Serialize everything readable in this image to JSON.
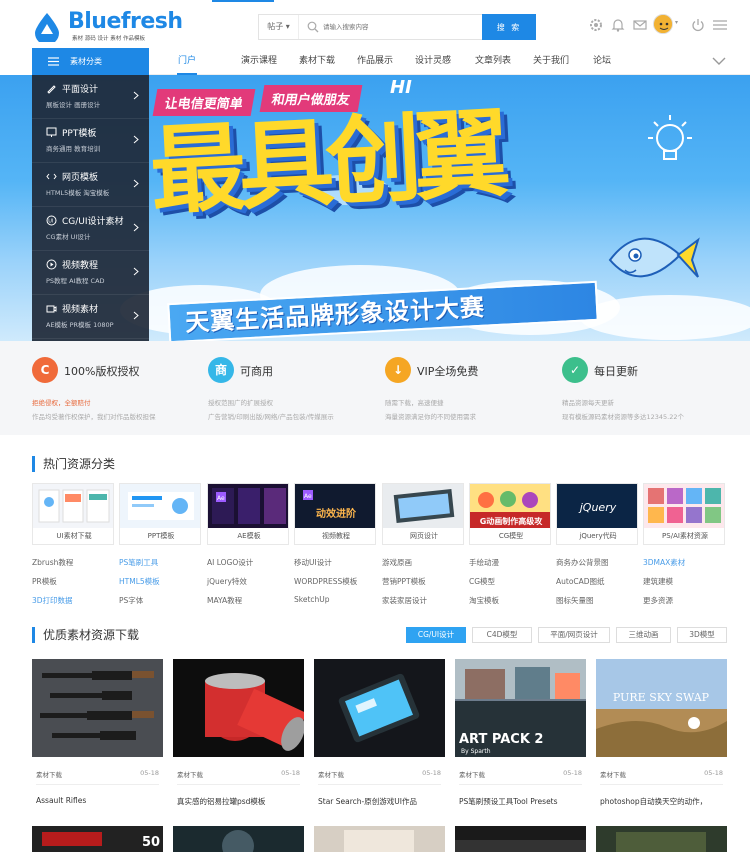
{
  "colors": {
    "accent": "#1e88e5",
    "sidebar_bg": "#1e2837",
    "feature_bg": "#f5f6f8",
    "tab_active": "#2fa3f2"
  },
  "header": {
    "logo_text": "Bluefresh",
    "logo_tagline": "素材 源码 设计 素材 作品模板",
    "search": {
      "category": "帖子",
      "placeholder": "请输入搜索内容",
      "button": "搜 索"
    },
    "icons": [
      "gear-icon",
      "bell-icon",
      "mail-icon",
      "avatar",
      "power-icon",
      "menu-icon"
    ]
  },
  "nav": {
    "category_button": "素材分类",
    "items": [
      "门户",
      "演示课程",
      "素材下载",
      "作品展示",
      "设计灵感",
      "文章列表",
      "关于我们",
      "论坛"
    ],
    "active_index": 0
  },
  "sidebar": {
    "items": [
      {
        "title": "平面设计",
        "sub": "展板设计   画册设计",
        "icon": "pen-icon"
      },
      {
        "title": "PPT模板",
        "sub": "商务通用   教育培训",
        "icon": "ppt-icon"
      },
      {
        "title": "网页模板",
        "sub": "HTML5模板   淘宝模板",
        "icon": "code-icon"
      },
      {
        "title": "CG/UI设计素材",
        "sub": "CG素材   UI设计",
        "icon": "ui-icon"
      },
      {
        "title": "视频教程",
        "sub": "PS教程   AI教程   CAD",
        "icon": "play-icon"
      },
      {
        "title": "视频素材",
        "sub": "AE模板   PR模板   1080P",
        "icon": "video-icon"
      }
    ]
  },
  "banner": {
    "tag1": "让电信更简单",
    "tag2": "和用户做朋友",
    "hi": "HI",
    "main": "最具创翼",
    "ribbon": "天翼生活品牌形象设计大赛"
  },
  "features": [
    {
      "icon_text": "C",
      "color": "#f06a3a",
      "title": "100%版权授权",
      "line1": "拒绝侵权，全额赔付",
      "line1_red": true,
      "line2": "作品均受著作权保护，我们对作品版权担保"
    },
    {
      "icon_text": "商",
      "color": "#35b7e8",
      "title": "可商用",
      "line1": "授权范围广的扩展授权",
      "line1_red": false,
      "line2": "广告营销/印刷出版/网络/产品包装/传媒展示"
    },
    {
      "icon_text": "↓",
      "color": "#f5a623",
      "title": "VIP全场免费",
      "line1": "随需下载，高速便捷",
      "line1_red": false,
      "line2": "海量资源满足你的不同使用需求"
    },
    {
      "icon_text": "✓",
      "color": "#3cbf8c",
      "title": "每日更新",
      "line1": "精品资源每天更新",
      "line1_red": false,
      "line2": "现有模板源码素材资源等多达12345.22个"
    }
  ],
  "hot": {
    "title": "热门资源分类",
    "categories": [
      "UI素材下载",
      "PPT模板",
      "AE模板",
      "视频教程",
      "网页设计",
      "CG模型",
      "jQuery代码",
      "PS/AI素材资源"
    ],
    "links": [
      [
        "Zbrush教程",
        "PS笔刷工具",
        "AI LOGO设计",
        "移动UI设计",
        "游戏原画",
        "手绘动漫",
        "商务办公背景图",
        "3DMAX素材"
      ],
      [
        "PR模板",
        "HTML5模板",
        "jQuery特效",
        "WORDPRESS模板",
        "营销PPT模板",
        "CG模型",
        "AutoCAD图纸",
        "建筑建模"
      ],
      [
        "3D打印数据",
        "PS字体",
        "MAYA教程",
        "SketchUp",
        "家装家居设计",
        "淘宝模板",
        "图标矢量图",
        "更多资源"
      ]
    ],
    "blue_links": [
      "PS笔刷工具",
      "3DMAX素材",
      "HTML5模板",
      "3D打印数据"
    ],
    "thumb_texts": {
      "jquery": "jQuery",
      "video": "动效进阶",
      "cg": "G动画制作高级攻"
    }
  },
  "quality": {
    "title": "优质素材资源下载",
    "tabs": [
      "CG/UI设计",
      "C4D模型",
      "平面/网页设计",
      "三维动画",
      "3D模型"
    ],
    "active_tab": 0,
    "cards": [
      {
        "category": "素材下载",
        "date": "05-18",
        "title": "Assault Rifles"
      },
      {
        "category": "素材下载",
        "date": "05-18",
        "title": "真实感的铝易拉罐psd模板"
      },
      {
        "category": "素材下载",
        "date": "05-18",
        "title": "Star Search-原创游戏UI作品"
      },
      {
        "category": "素材下载",
        "date": "05-18",
        "title": "PS笔刷预设工具Tool Presets"
      },
      {
        "category": "素材下载",
        "date": "05-18",
        "title": "photoshop自动换天空的动作，"
      }
    ],
    "card_overlays": {
      "art_pack": "ART PACK 2",
      "art_pack_sub": "By Sparth",
      "sky_swap": "PURE SKY SWAP",
      "second_row_number": "50"
    }
  }
}
